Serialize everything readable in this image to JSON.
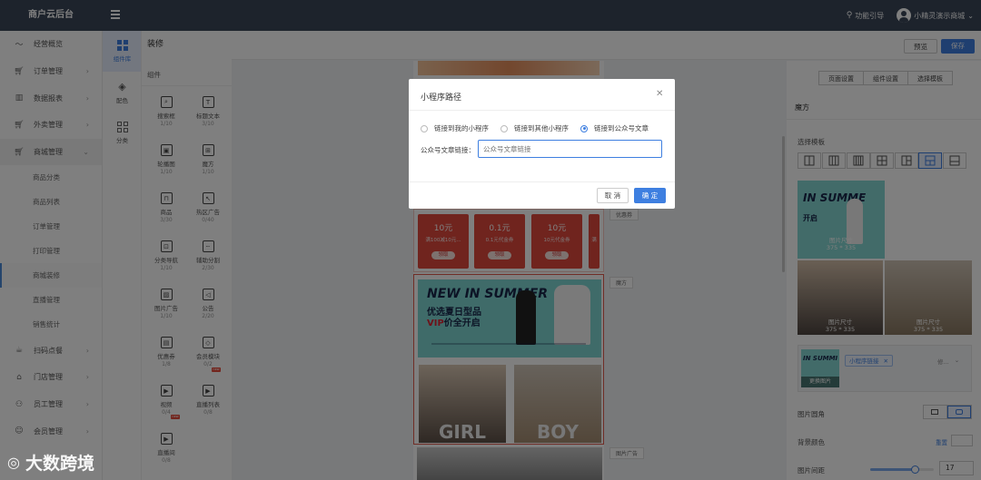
{
  "topbar": {
    "brand": "商户云后台",
    "guide": "功能引导",
    "user": "小精灵演示商城"
  },
  "sidebar": {
    "items": [
      {
        "label": "经营概览",
        "icon": "trend-icon",
        "arrow": ""
      },
      {
        "label": "订单管理",
        "icon": "cart-icon",
        "arrow": "›"
      },
      {
        "label": "数据报表",
        "icon": "chart-icon",
        "arrow": "›"
      },
      {
        "label": "外卖管理",
        "icon": "bag-icon",
        "arrow": "›"
      },
      {
        "label": "商城管理",
        "icon": "cart-icon",
        "arrow": "⌄"
      }
    ],
    "sub": [
      "商品分类",
      "商品列表",
      "订单管理",
      "打印管理",
      "商城装修",
      "直播管理",
      "销售统计"
    ],
    "items2": [
      {
        "label": "扫码点餐",
        "icon": "cup-icon"
      },
      {
        "label": "门店管理",
        "icon": "home-icon"
      },
      {
        "label": "员工管理",
        "icon": "user-icon"
      },
      {
        "label": "会员管理",
        "icon": "smile-icon"
      }
    ]
  },
  "categories": [
    {
      "label": "组件库"
    },
    {
      "label": "配色"
    },
    {
      "label": "分类"
    }
  ],
  "page": {
    "title": "装修",
    "components_heading": "组件"
  },
  "components": [
    {
      "label": "搜索框",
      "count": "1/10",
      "glyph": "⌕"
    },
    {
      "label": "标题文本",
      "count": "3/10",
      "glyph": "T"
    },
    {
      "label": "轮播图",
      "count": "1/10",
      "glyph": "▣"
    },
    {
      "label": "魔方",
      "count": "1/10",
      "glyph": "⊞"
    },
    {
      "label": "商品",
      "count": "3/30",
      "glyph": "⊓"
    },
    {
      "label": "热区广告",
      "count": "0/40",
      "glyph": "↖"
    },
    {
      "label": "分类导航",
      "count": "1/10",
      "glyph": "⊡"
    },
    {
      "label": "辅助分割",
      "count": "2/30",
      "glyph": "┄"
    },
    {
      "label": "图片广告",
      "count": "1/10",
      "glyph": "▨"
    },
    {
      "label": "公告",
      "count": "2/20",
      "glyph": "◁"
    },
    {
      "label": "优惠券",
      "count": "1/8",
      "glyph": "▤"
    },
    {
      "label": "会员模块",
      "count": "0/2",
      "glyph": "◇"
    },
    {
      "label": "视频",
      "count": "0/4",
      "glyph": "▶"
    },
    {
      "label": "直播列表",
      "count": "0/8",
      "glyph": "▶"
    },
    {
      "label": "直播间",
      "count": "0/8",
      "glyph": "▶"
    }
  ],
  "actions": {
    "preview": "预览",
    "save": "保存"
  },
  "coupons": [
    {
      "amount": "10元",
      "desc": "满100减10元...",
      "get": "领取"
    },
    {
      "amount": "0.1元",
      "desc": "0.1元代金券",
      "get": "领取"
    },
    {
      "amount": "10元",
      "desc": "10元代金券",
      "get": "领取"
    },
    {
      "amount": "",
      "desc": "满",
      "get": ""
    }
  ],
  "canvas": {
    "tag_coupon": "优惠券",
    "tag_cube": "魔方",
    "tag_ad": "图片广告",
    "banner_title": "NEW IN SUMMER",
    "banner_line1": "优选夏日型品",
    "banner_vip": "VIP",
    "banner_line2": "价全开启",
    "girl": "GIRL",
    "boy": "BOY"
  },
  "right": {
    "tabs": [
      "页面设置",
      "组件设置",
      "选择模板"
    ],
    "section": "魔方",
    "template_label": "选择模板",
    "preview_title": "IN SUMME",
    "preview_sub": "开启",
    "size_label_big": "图片尺寸",
    "size_value_big": "375 * 335",
    "size_label": "图片尺寸",
    "size_value": "375 * 335",
    "thumb_title": "IN SUMMI",
    "thumb_change": "更换图片",
    "link_chip": "小程序链接",
    "link_more": "修...",
    "corner_label": "图片圆角",
    "bg_label": "背景颜色",
    "bg_reset": "重置",
    "gap_label": "图片间距",
    "gap_value": "17",
    "gap_fraction": 0.71
  },
  "modal": {
    "title": "小程序路径",
    "options": [
      "链接到我的小程序",
      "链接到其他小程序",
      "链接到公众号文章"
    ],
    "selected": 2,
    "field_label": "公众号文章链接：",
    "placeholder": "公众号文章链接",
    "cancel": "取 消",
    "confirm": "确 定"
  },
  "watermark": "大数跨境",
  "colors": {
    "primary": "#3e7fe0",
    "topbar": "#3a4659",
    "coupon": "#e1483d"
  }
}
